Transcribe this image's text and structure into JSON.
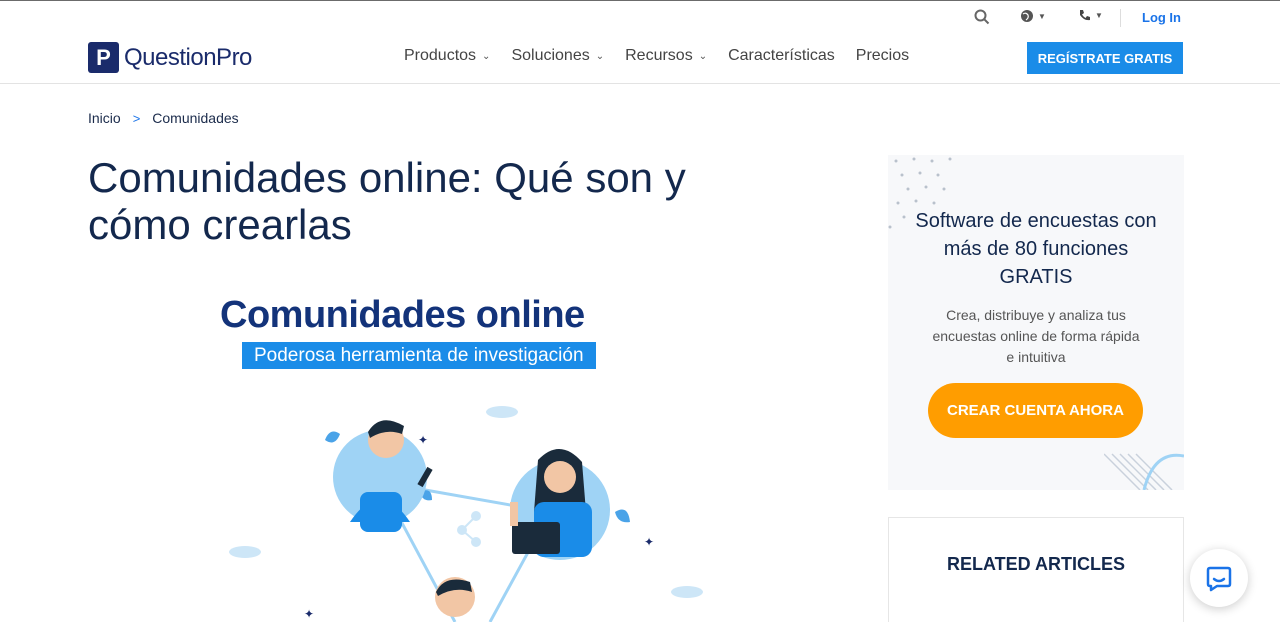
{
  "topbar": {
    "login_label": "Log In",
    "icons": [
      "search-icon",
      "globe-icon",
      "phone-icon"
    ]
  },
  "nav": {
    "logo_text": "QuestionPro",
    "logo_mark": "P",
    "items": [
      {
        "label": "Productos",
        "has_dropdown": true
      },
      {
        "label": "Soluciones",
        "has_dropdown": true
      },
      {
        "label": "Recursos",
        "has_dropdown": true
      },
      {
        "label": "Características",
        "has_dropdown": false
      },
      {
        "label": "Precios",
        "has_dropdown": false
      }
    ],
    "cta_label": "REGÍSTRATE GRATIS"
  },
  "breadcrumb": {
    "home": "Inicio",
    "current": "Comunidades"
  },
  "page": {
    "title": "Comunidades online: Qué son y cómo crearlas"
  },
  "hero": {
    "title": "Comunidades online",
    "subtitle": "Poderosa herramienta de investigación"
  },
  "promo": {
    "title": "Software de encuestas con más de 80 funciones GRATIS",
    "description": "Crea, distribuye y analiza tus encuestas online de forma rápida e intuitiva",
    "button_label": "CREAR CUENTA AHORA"
  },
  "related": {
    "title": "RELATED ARTICLES"
  },
  "colors": {
    "brand_navy": "#1a2b6b",
    "accent_blue": "#1a8ce8",
    "cta_orange": "#ff9d00"
  }
}
